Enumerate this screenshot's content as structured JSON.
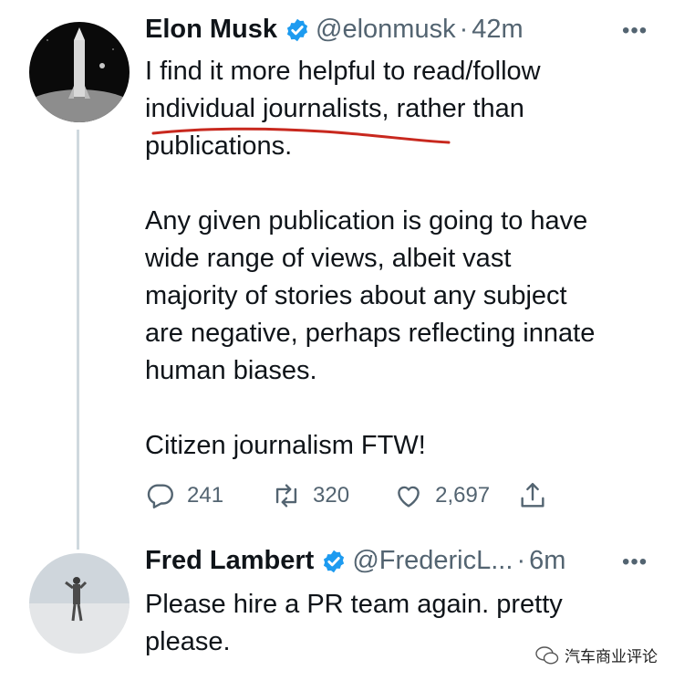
{
  "tweets": [
    {
      "name": "Elon Musk",
      "handle": "@elonmusk",
      "dot": "·",
      "time": "42m",
      "more": "•••",
      "text": "I find it more helpful to read/follow\nindividual journalists, rather than\npublications.\n\nAny given publication is going to have\nwide range of views, albeit vast\nmajority of stories about any subject\nare negative, perhaps reflecting innate\nhuman biases.\n\nCitizen journalism FTW!",
      "replies": "241",
      "retweets": "320",
      "likes": "2,697"
    },
    {
      "name": "Fred Lambert",
      "handle": "@FredericL...",
      "dot": "·",
      "time": "6m",
      "more": "•••",
      "text": "Please hire a PR team again. pretty\nplease."
    }
  ],
  "watermark": {
    "text": "汽车商业评论"
  },
  "colors": {
    "verified": "#1d9bf0",
    "secondary": "#536471",
    "annotation": "#c8281e"
  }
}
